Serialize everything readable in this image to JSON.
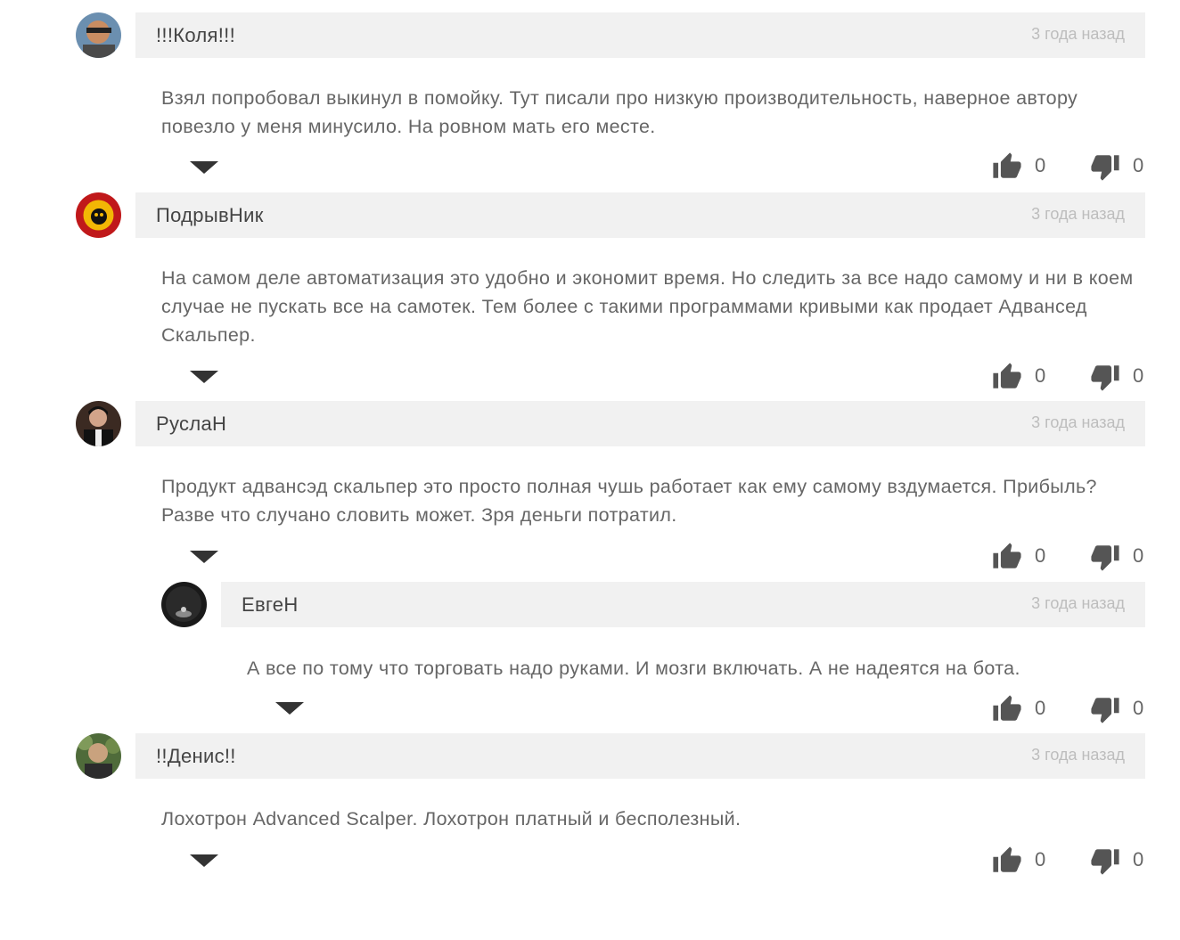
{
  "comments": [
    {
      "author": "!!!Коля!!!",
      "date": "3 года назад",
      "text": "Взял попробовал выкинул в помойку. Тут писали про низкую производительность, наверное автору повезло у меня минусило. На ровном мать его месте.",
      "likes": "0",
      "dislikes": "0"
    },
    {
      "author": "ПодрывНик",
      "date": "3 года назад",
      "text": "На самом деле автоматизация это удобно и экономит время. Но следить за все надо самому и ни в коем случае не пускать все на самотек. Тем более с такими программами кривыми как продает Адвансед Скальпер.",
      "likes": "0",
      "dislikes": "0"
    },
    {
      "author": "РуслаН",
      "date": "3 года назад",
      "text": "Продукт адвансэд скальпер это просто полная чушь работает как ему самому вздумается. Прибыль? Разве что случано словить может. Зря деньги потратил.",
      "likes": "0",
      "dislikes": "0"
    },
    {
      "author": "ЕвгеН",
      "date": "3 года назад",
      "text": "А все по тому что торговать надо руками. И мозги включать. А не надеятся на бота.",
      "likes": "0",
      "dislikes": "0"
    },
    {
      "author": "!!Денис!!",
      "date": "3 года назад",
      "text": "Лохотрон Advanced Scalper. Лохотрон платный и бесполезный.",
      "likes": "0",
      "dislikes": "0"
    }
  ],
  "icons": {
    "like": "thumbs-up-icon",
    "dislike": "thumbs-down-icon",
    "toggle": "caret-down-icon"
  },
  "colors": {
    "header_bg": "#f1f1f1",
    "text": "#666666",
    "date": "#bdbdbd",
    "icon": "#555555"
  }
}
